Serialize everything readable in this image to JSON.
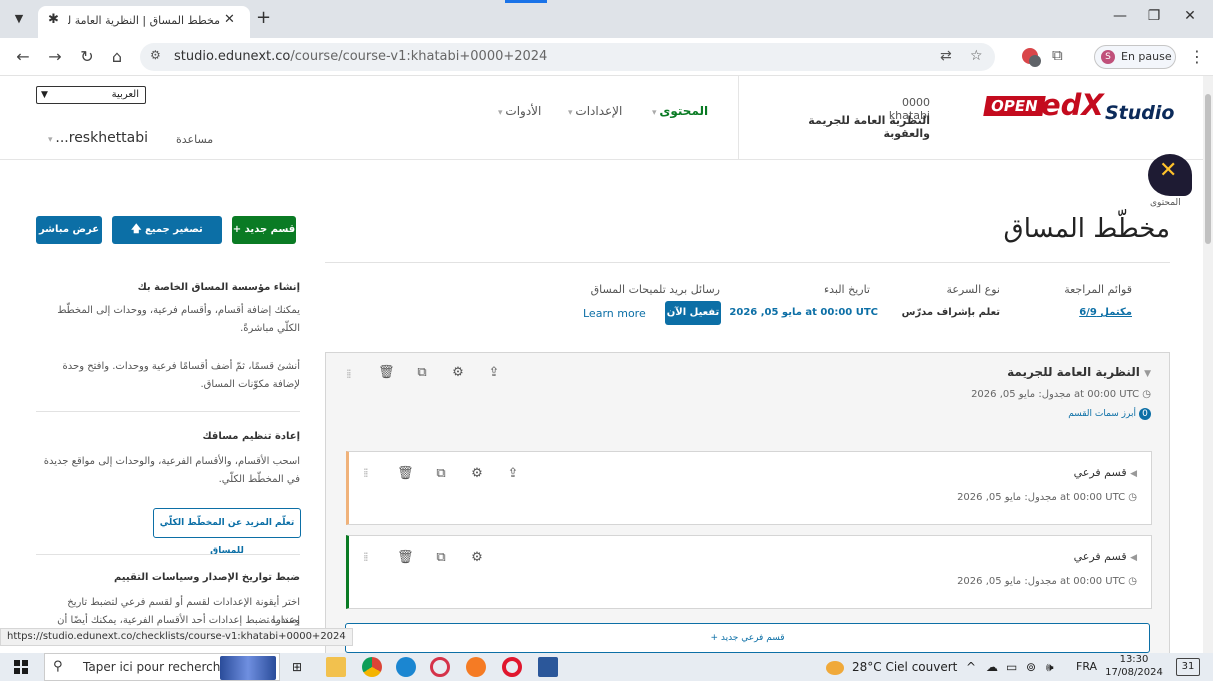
{
  "browser": {
    "tab_menu_icon": "chevron-down",
    "tab_pin": "✱",
    "tab_title": "مخطط المساق | النظرية العامة لـ",
    "tab_close": "✕",
    "new_tab": "+",
    "window_controls": [
      "—",
      "❐",
      "✕"
    ],
    "url_host": "studio.edunext.co",
    "url_path": "/course/course-v1:khatabi+0000+2024",
    "profile_initial": "S",
    "profile_label": "En pause",
    "ext_badge": "2"
  },
  "header": {
    "language": "العربية",
    "user": "...reskhettabi",
    "help": "مساعدة",
    "nav": {
      "content": "المحتوى",
      "settings": "الإعدادات",
      "tools": "الأدوات"
    },
    "course_org": "0000 khatabi",
    "course_name": "النظرية العامة للجريمة والعقوبة",
    "logo": {
      "open": "OPEN",
      "edx": "edX",
      "studio": "Studio"
    }
  },
  "page": {
    "breadcrumb": "المحتوى",
    "title": "مخطّط المساق",
    "buttons": {
      "view_live": "عرض مباشر",
      "collapse_all": "تصغير جميع الأقسام",
      "new_section": "قسم جديد"
    }
  },
  "stats": {
    "checklists_label": "قوائم المراجعة",
    "checklists_value": "مكتمل 6/9",
    "pacing_label": "نوع السرعة",
    "pacing_value": "تعلم بإشراف مدرّس",
    "start_label": "تاريخ البدء",
    "start_value": "مايو 05, 2026 at 00:00 UTC",
    "email_label": "رسائل بريد تلميحات المساق",
    "activate": "تفعيل الآن",
    "learn_more": "Learn more"
  },
  "sidebar": {
    "h1": "إنشاء مؤسسة المساق الخاصة بك",
    "p1": "يمكنك إضافة أقسام، وأقسام فرعية، ووحدات إلى المخطّط الكلّي مباشرةً.",
    "p2": "أنشئ قسمًا، ثمّ أضف أقسامًا فرعية ووحدات. وافتح وحدة لإضافة مكوّنات المساق.",
    "h2": "إعادة تنظيم مساقك",
    "p3": "اسحب الأقسام، والأقسام الفرعية، والوحدات إلى مواقع جديدة في المخطّط الكلّي.",
    "learn_btn": "تعلّم المزيد عن المخطّط الكلّي للمساق",
    "h3": "ضبط تواريخ الإصدار وسياسات التقييم",
    "p4": "اختر أيقونة الإعدادات لقسم أو لقسم فرعي لتضبط تاريخ إصداره.",
    "p5": "وعندما تضبط إعدادات أحد الأقسام الفرعية، يمكنك أيضًا أن تضبط"
  },
  "outline": {
    "section_title": "النظرية العامة للجريمة",
    "section_meta": "مجدول: مايو 05, 2026 at 00:00 UTC",
    "highlights_count": "0",
    "highlights_label": "أبرز سمات القسم",
    "subsections": [
      {
        "title": "قسم فرعي",
        "meta": "مجدول: مايو 05, 2026 at 00:00 UTC"
      },
      {
        "title": "قسم فرعي",
        "meta": "مجدول: مايو 05, 2026 at 00:00 UTC"
      }
    ],
    "new_subsection": "قسم فرعي جديد"
  },
  "status_url": "https://studio.edunext.co/checklists/course-v1:khatabi+0000+2024",
  "taskbar": {
    "search_placeholder": "Taper ici pour rechercher",
    "weather": "28°C Ciel couvert",
    "lang": "FRA",
    "time": "13:30",
    "date": "17/08/2024",
    "notifications": "31"
  }
}
